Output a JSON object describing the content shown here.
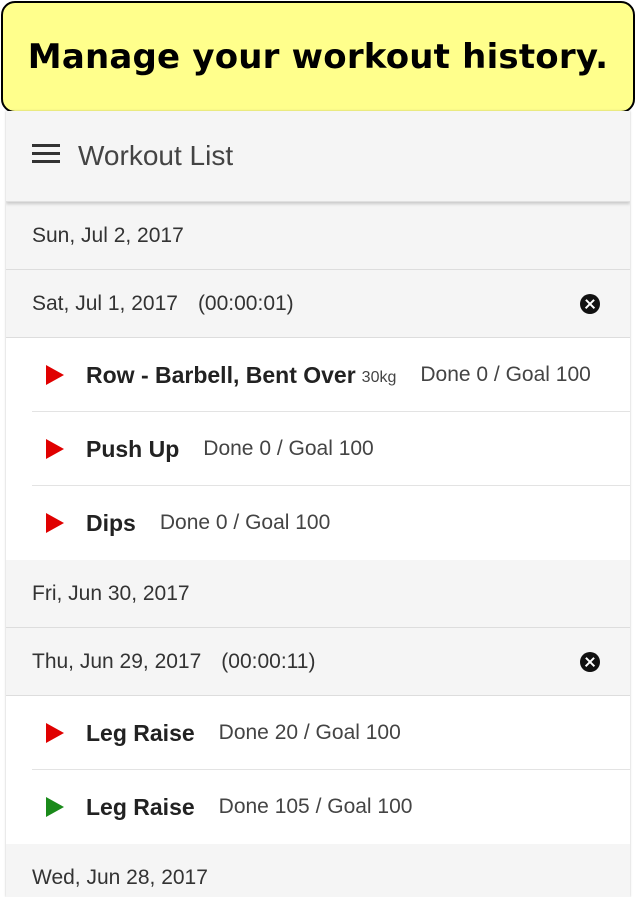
{
  "banner": {
    "text": "Manage your workout history."
  },
  "appbar": {
    "title": "Workout List",
    "menu_icon": "hamburger-menu-icon"
  },
  "colors": {
    "banner_bg": "#ffff8c",
    "play_red": "#e00000",
    "play_green": "#1a8a1a"
  },
  "list": {
    "d1": {
      "date": "Sun, Jul 2, 2017"
    },
    "d2": {
      "date": "Sat, Jul 1, 2017",
      "duration": "(00:00:01)"
    },
    "d2_items": [
      {
        "name": "Row - Barbell, Bent Over",
        "weight": "30kg",
        "progress": "Done 0 / Goal 100",
        "status": "incomplete"
      },
      {
        "name": "Push Up",
        "progress": "Done 0 / Goal 100",
        "status": "incomplete"
      },
      {
        "name": "Dips",
        "progress": "Done 0 / Goal 100",
        "status": "incomplete"
      }
    ],
    "d3": {
      "date": "Fri, Jun 30, 2017"
    },
    "d4": {
      "date": "Thu, Jun 29, 2017",
      "duration": "(00:00:11)"
    },
    "d4_items": [
      {
        "name": "Leg Raise",
        "progress": "Done 20 / Goal 100",
        "status": "incomplete"
      },
      {
        "name": "Leg Raise",
        "progress": "Done 105 / Goal 100",
        "status": "complete"
      }
    ],
    "d5": {
      "date": "Wed, Jun 28, 2017"
    }
  }
}
